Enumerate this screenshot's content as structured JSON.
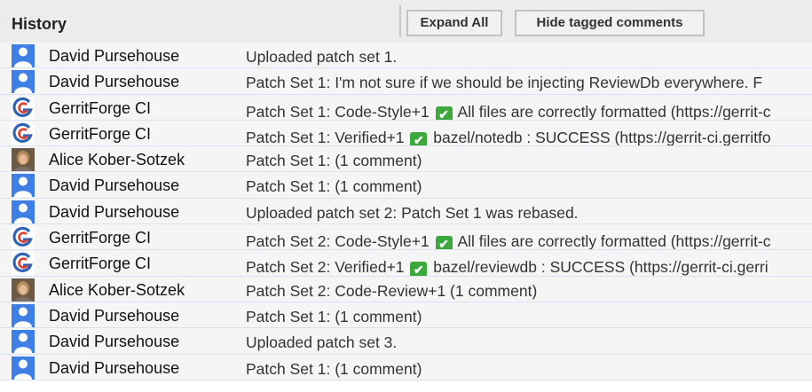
{
  "header": {
    "title": "History",
    "expand_all_label": "Expand All",
    "hide_tagged_label": "Hide tagged comments"
  },
  "colors": {
    "row_background": "#f5f5f5",
    "row_divider": "#d8e4f3",
    "header_background": "#ececec",
    "default_avatar_blue": "#3e7fe6",
    "check_green": "#3aa83a"
  },
  "rows": [
    {
      "avatar": "default-user-icon",
      "author": "David Pursehouse",
      "message": "Uploaded patch set 1.",
      "check": false
    },
    {
      "avatar": "default-user-icon",
      "author": "David Pursehouse",
      "message": "Patch Set 1: I'm not sure if we should be injecting ReviewDb everywhere. F",
      "check": false
    },
    {
      "avatar": "gerritforge-logo-icon",
      "author": "GerritForge CI",
      "message_pre": "Patch Set 1: Code-Style+1",
      "message_post": "All files are correctly formatted (https://gerrit-c",
      "check": true
    },
    {
      "avatar": "gerritforge-logo-icon",
      "author": "GerritForge CI",
      "message_pre": "Patch Set 1: Verified+1",
      "message_post": "bazel/notedb : SUCCESS (https://gerrit-ci.gerritfo",
      "check": true
    },
    {
      "avatar": "user-photo-icon",
      "author": "Alice Kober-Sotzek",
      "message": "Patch Set 1: (1 comment)",
      "check": false
    },
    {
      "avatar": "default-user-icon",
      "author": "David Pursehouse",
      "message": "Patch Set 1: (1 comment)",
      "check": false
    },
    {
      "avatar": "default-user-icon",
      "author": "David Pursehouse",
      "message": "Uploaded patch set 2: Patch Set 1 was rebased.",
      "check": false
    },
    {
      "avatar": "gerritforge-logo-icon",
      "author": "GerritForge CI",
      "message_pre": "Patch Set 2: Code-Style+1",
      "message_post": "All files are correctly formatted (https://gerrit-c",
      "check": true
    },
    {
      "avatar": "gerritforge-logo-icon",
      "author": "GerritForge CI",
      "message_pre": "Patch Set 2: Verified+1",
      "message_post": "bazel/reviewdb : SUCCESS (https://gerrit-ci.gerri",
      "check": true
    },
    {
      "avatar": "user-photo-icon",
      "author": "Alice Kober-Sotzek",
      "message": "Patch Set 2: Code-Review+1 (1 comment)",
      "check": false
    },
    {
      "avatar": "default-user-icon",
      "author": "David Pursehouse",
      "message": "Patch Set 1: (1 comment)",
      "check": false
    },
    {
      "avatar": "default-user-icon",
      "author": "David Pursehouse",
      "message": "Uploaded patch set 3.",
      "check": false
    },
    {
      "avatar": "default-user-icon",
      "author": "David Pursehouse",
      "message": "Patch Set 1: (1 comment)",
      "check": false
    }
  ]
}
